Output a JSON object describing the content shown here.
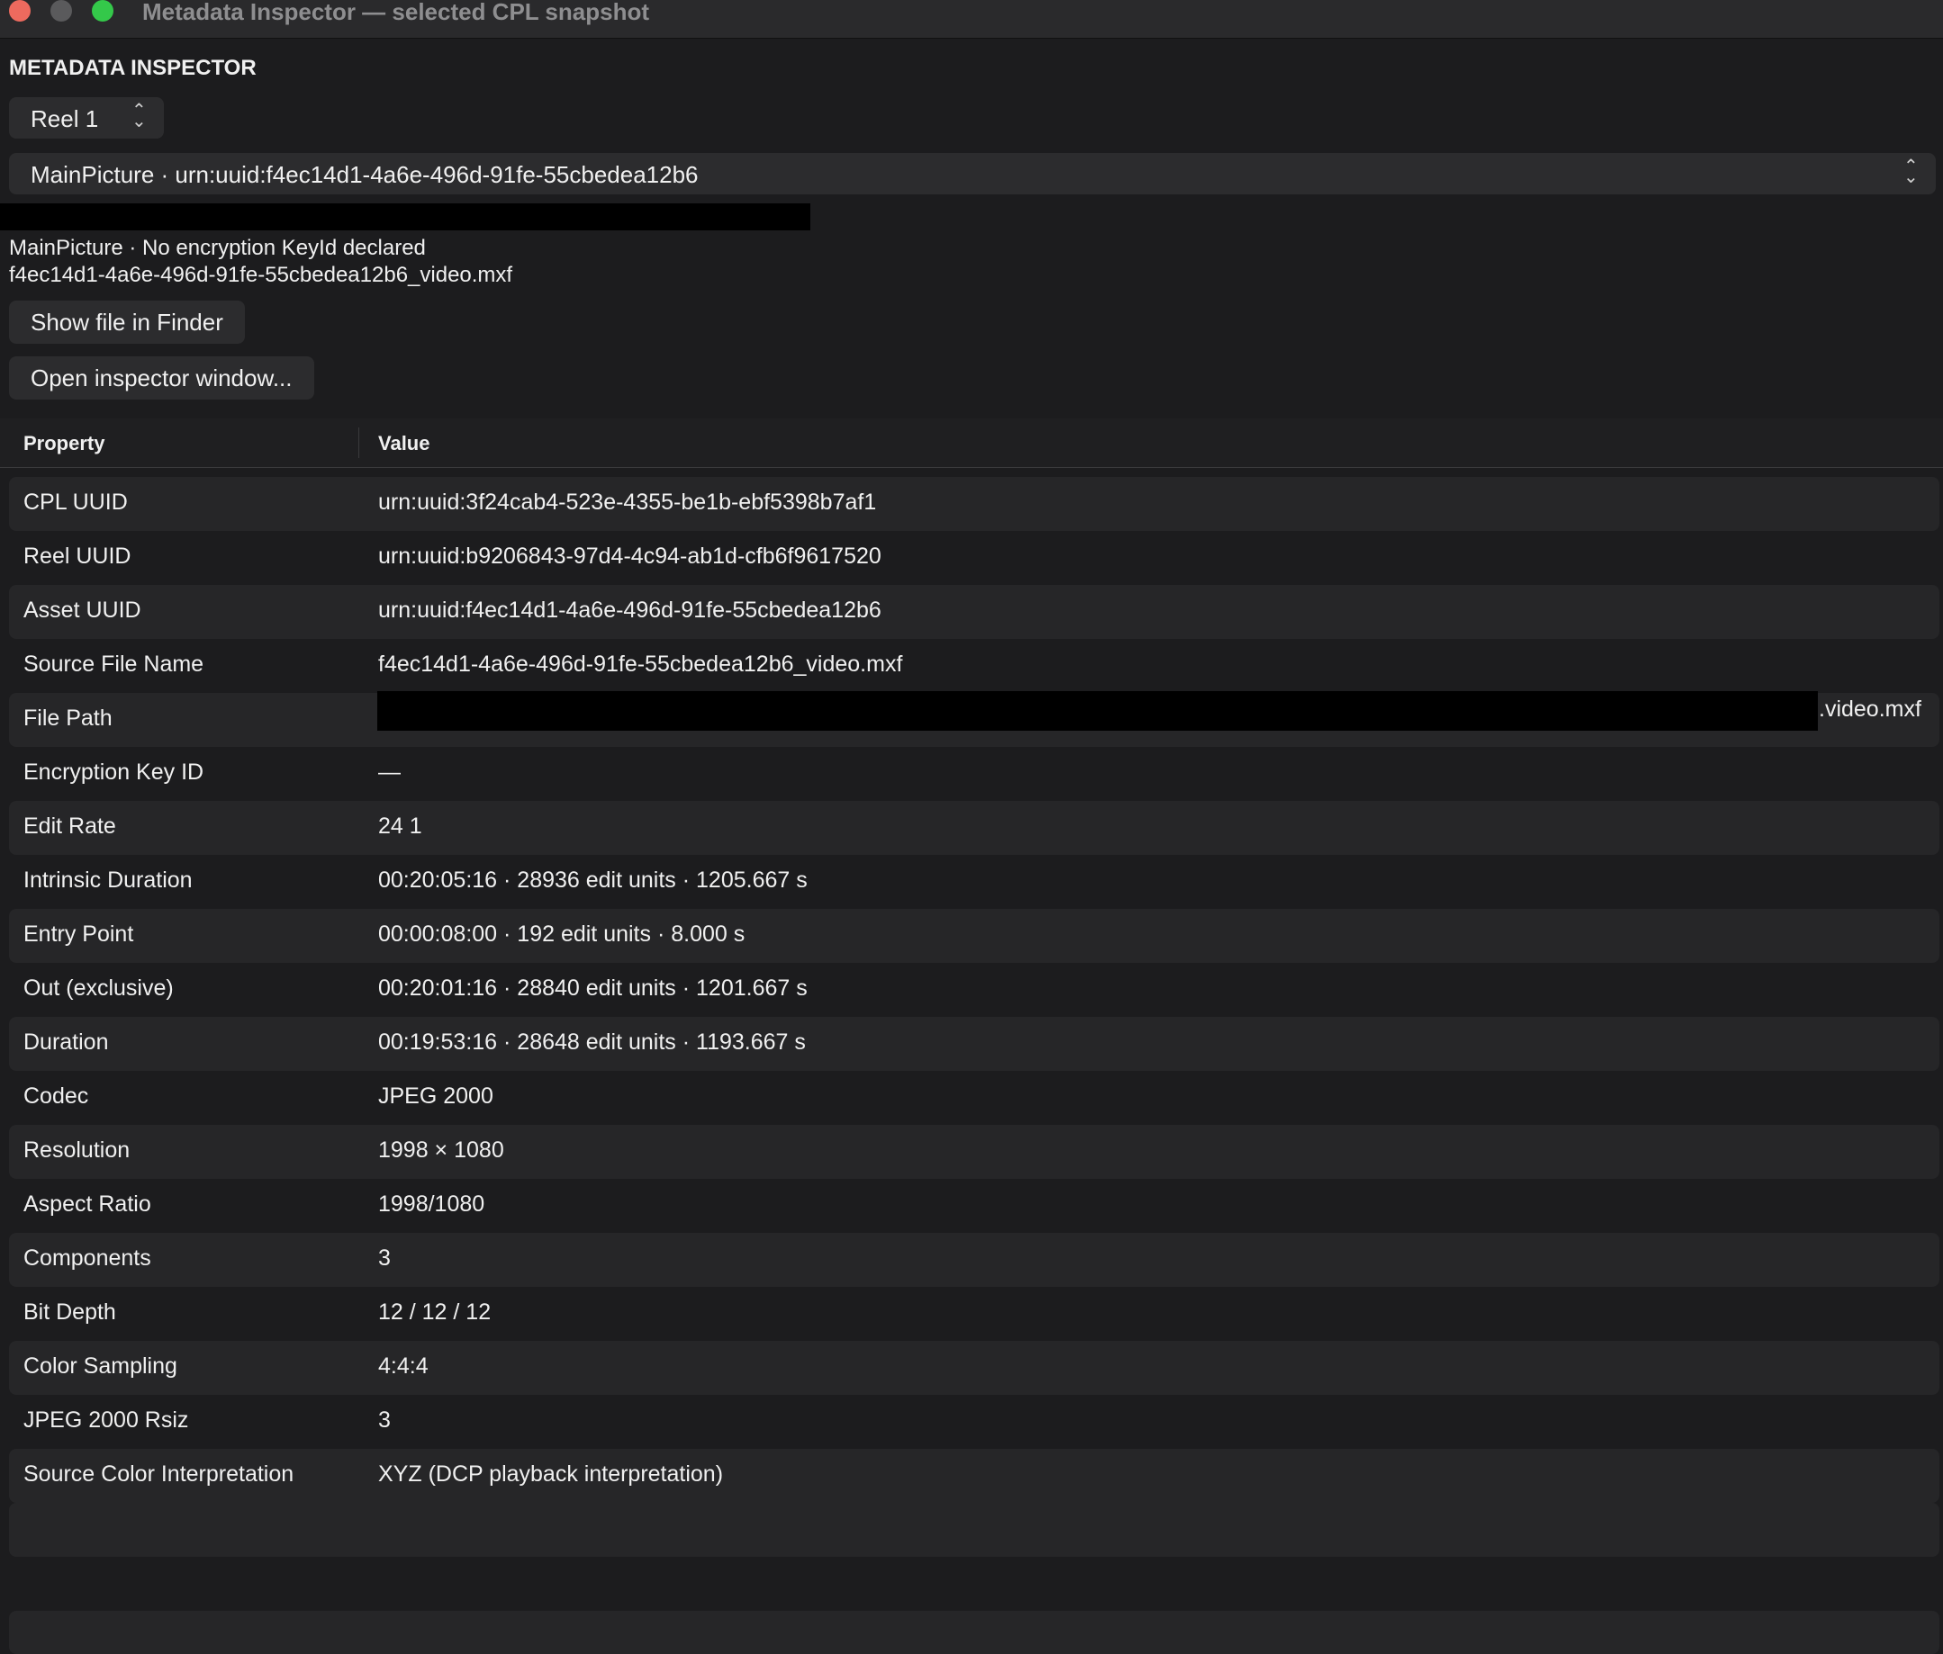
{
  "window": {
    "title": "Metadata Inspector — selected CPL snapshot"
  },
  "panel": {
    "header": "METADATA INSPECTOR"
  },
  "reel_select": {
    "value": "Reel 1"
  },
  "asset_select": {
    "value": "MainPicture · urn:uuid:f4ec14d1-4a6e-496d-91fe-55cbedea12b6"
  },
  "info": {
    "line1": "MainPicture · No encryption KeyId declared",
    "line2": "f4ec14d1-4a6e-496d-91fe-55cbedea12b6_video.mxf"
  },
  "buttons": {
    "show_in_finder": "Show file in Finder",
    "open_inspector": "Open inspector window..."
  },
  "table": {
    "headers": {
      "property": "Property",
      "value": "Value"
    },
    "rows": [
      {
        "property": "CPL UUID",
        "value": "urn:uuid:3f24cab4-523e-4355-be1b-ebf5398b7af1"
      },
      {
        "property": "Reel UUID",
        "value": "urn:uuid:b9206843-97d4-4c94-ab1d-cfb6f9617520"
      },
      {
        "property": "Asset UUID",
        "value": "urn:uuid:f4ec14d1-4a6e-496d-91fe-55cbedea12b6"
      },
      {
        "property": "Source File Name",
        "value": "f4ec14d1-4a6e-496d-91fe-55cbedea12b6_video.mxf"
      },
      {
        "property": "File Path",
        "value": ".video.mxf"
      },
      {
        "property": "Encryption Key ID",
        "value": "—"
      },
      {
        "property": "Edit Rate",
        "value": "24 1"
      },
      {
        "property": "Intrinsic Duration",
        "value": "00:20:05:16 · 28936 edit units · 1205.667 s"
      },
      {
        "property": "Entry Point",
        "value": "00:00:08:00 · 192 edit units · 8.000 s"
      },
      {
        "property": "Out (exclusive)",
        "value": "00:20:01:16 · 28840 edit units · 1201.667 s"
      },
      {
        "property": "Duration",
        "value": "00:19:53:16 · 28648 edit units · 1193.667 s"
      },
      {
        "property": "Codec",
        "value": "JPEG 2000"
      },
      {
        "property": "Resolution",
        "value": "1998 × 1080"
      },
      {
        "property": "Aspect Ratio",
        "value": "1998/1080"
      },
      {
        "property": "Components",
        "value": "3"
      },
      {
        "property": "Bit Depth",
        "value": "12 / 12 / 12"
      },
      {
        "property": "Color Sampling",
        "value": "4:4:4"
      },
      {
        "property": "JPEG 2000 Rsiz",
        "value": "3"
      },
      {
        "property": "Source Color Interpretation",
        "value": "XYZ (DCP playback interpretation)"
      }
    ]
  },
  "colors": {
    "background": "#1c1c1e",
    "row_alt": "#262628",
    "close": "#ed6a5e",
    "zoom": "#34c84a"
  }
}
